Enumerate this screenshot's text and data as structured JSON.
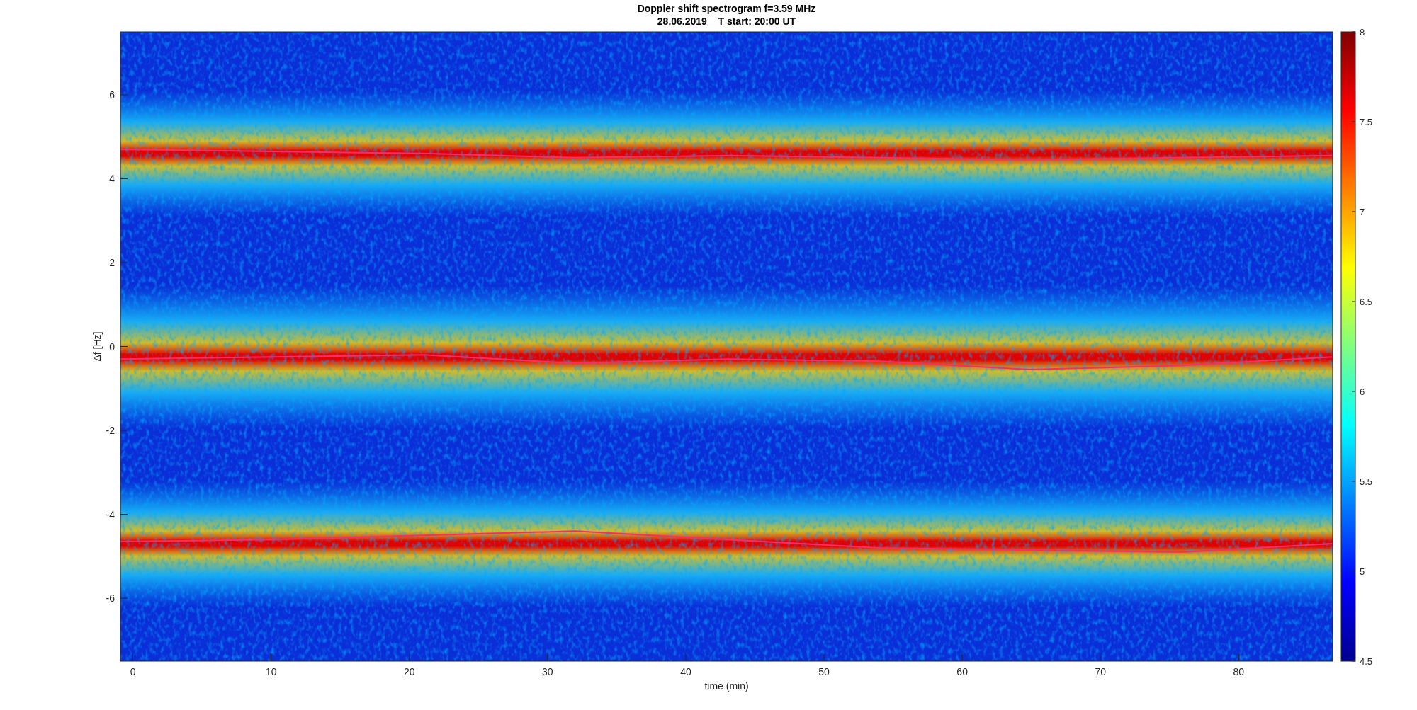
{
  "figure": {
    "title_lines": [
      "Doppler shift spectrogram f=3.59 MHz",
      "28.06.2019    T start: 20:00 UT"
    ],
    "xlabel": "time (min)",
    "ylabel": "Δf [Hz]",
    "xticks": [
      "0",
      "10",
      "20",
      "30",
      "40",
      "50",
      "60",
      "70",
      "80"
    ],
    "yticks": [
      "6",
      "4",
      "2",
      "0",
      "-2",
      "-4",
      "-6"
    ],
    "colorbar": {
      "ticks": [
        "8",
        "7.5",
        "7",
        "6.5",
        "6",
        "5.5",
        "5",
        "4.5"
      ]
    }
  }
}
